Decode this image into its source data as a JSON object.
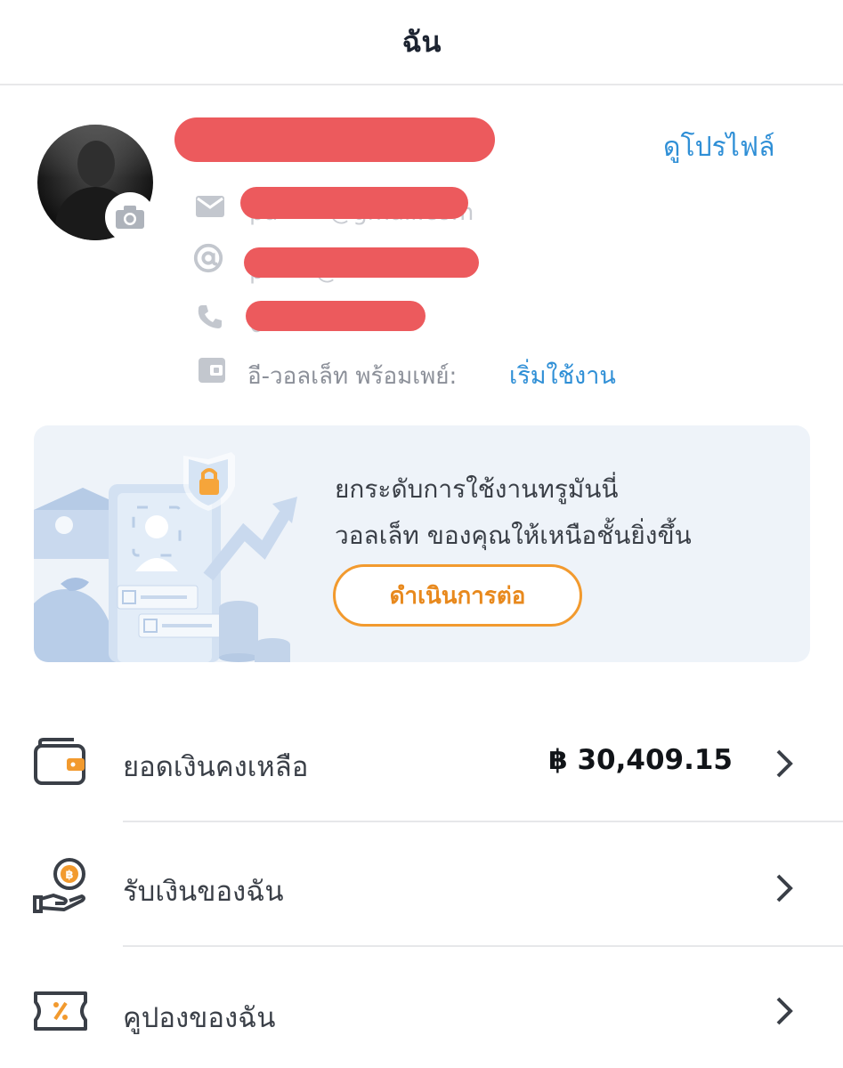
{
  "header": {
    "title": "ฉัน"
  },
  "profile": {
    "view_profile_label": "ดูโปรไฟล์",
    "ewallet": {
      "label": "อี-วอลเล็ท พร้อมเพย์:",
      "action": "เริ่มใช้งาน"
    },
    "icons": [
      "camera-icon",
      "mail-icon",
      "at-icon",
      "phone-icon",
      "wallet-card-icon"
    ]
  },
  "banner": {
    "line1": "ยกระดับการใช้งานทรูมันนี่",
    "line2": "วอลเล็ท ของคุณให้เหนือชั้นยิ่งขึ้น",
    "button_label": "ดำเนินการต่อ"
  },
  "menu": [
    {
      "label": "ยอดเงินคงเหลือ",
      "value": "฿ 30,409.15",
      "icon": "wallet-icon"
    },
    {
      "label": "รับเงินของฉัน",
      "value": "",
      "icon": "receive-money-icon"
    },
    {
      "label": "คูปองของฉัน",
      "value": "",
      "icon": "coupon-icon"
    }
  ],
  "colors": {
    "accent_blue": "#2f8fd6",
    "accent_orange": "#f29a2e",
    "redaction": "#ec5a5d"
  }
}
